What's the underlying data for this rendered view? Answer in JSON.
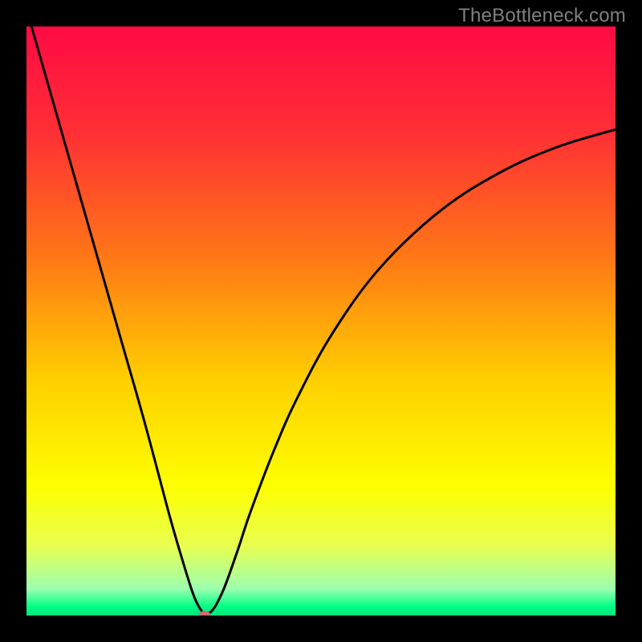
{
  "watermark": "TheBottleneck.com",
  "chart_data": {
    "type": "line",
    "title": "",
    "xlabel": "",
    "ylabel": "",
    "xlim": [
      0,
      100
    ],
    "ylim": [
      0,
      100
    ],
    "gradient_stops": [
      {
        "offset": 0,
        "color": "#ff0a44"
      },
      {
        "offset": 18,
        "color": "#ff2f35"
      },
      {
        "offset": 40,
        "color": "#ff7a15"
      },
      {
        "offset": 60,
        "color": "#ffcf00"
      },
      {
        "offset": 78,
        "color": "#fdff00"
      },
      {
        "offset": 88,
        "color": "#e9ff4e"
      },
      {
        "offset": 95.5,
        "color": "#9cffb0"
      },
      {
        "offset": 98.5,
        "color": "#00ff85"
      },
      {
        "offset": 100,
        "color": "#00e27b"
      }
    ],
    "series": [
      {
        "name": "bottleneck-curve",
        "x": [
          0,
          4,
          8,
          12,
          16,
          20,
          24,
          26,
          28,
          29,
          30,
          31,
          32,
          33,
          34,
          36,
          38,
          42,
          46,
          52,
          60,
          70,
          80,
          90,
          100
        ],
        "y": [
          103,
          89,
          75,
          61,
          47,
          33,
          18,
          11,
          4.5,
          2.0,
          0.5,
          0.4,
          1.5,
          3.4,
          5.8,
          11.5,
          17.5,
          28,
          37,
          48,
          59,
          68.5,
          75,
          79.5,
          82.5
        ]
      }
    ],
    "marker": {
      "x": 30.3,
      "y": 0.2
    },
    "annotations": []
  }
}
